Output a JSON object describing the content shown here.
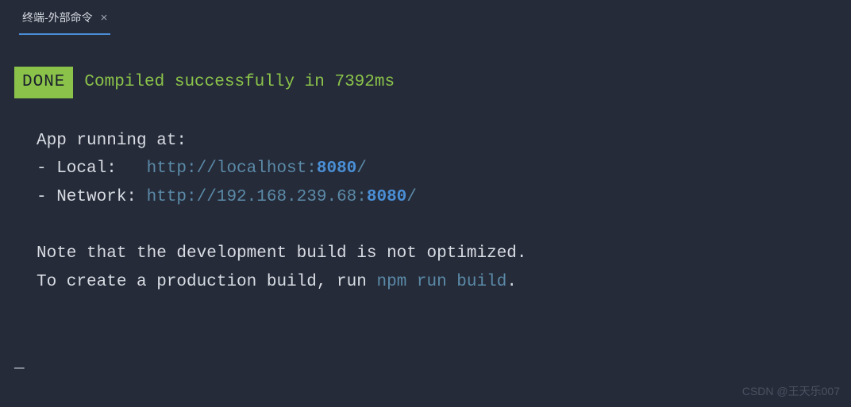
{
  "tab": {
    "label": "终端-外部命令",
    "close": "×"
  },
  "status": {
    "badge": " DONE ",
    "message": "Compiled successfully in 7392ms"
  },
  "output": {
    "app_running": "App running at:",
    "local_label": "- Local:   ",
    "local_scheme": "http://localhost:",
    "local_port": "8080",
    "local_trail": "/",
    "network_label": "- Network: ",
    "network_scheme": "http://192.168.239.68:",
    "network_port": "8080",
    "network_trail": "/",
    "note1": "Note that the development build is not optimized.",
    "note2_pre": "To create a production build, run ",
    "note2_cmd": "npm run build",
    "note2_post": "."
  },
  "cursor": "_",
  "watermark": "CSDN @王天乐007"
}
